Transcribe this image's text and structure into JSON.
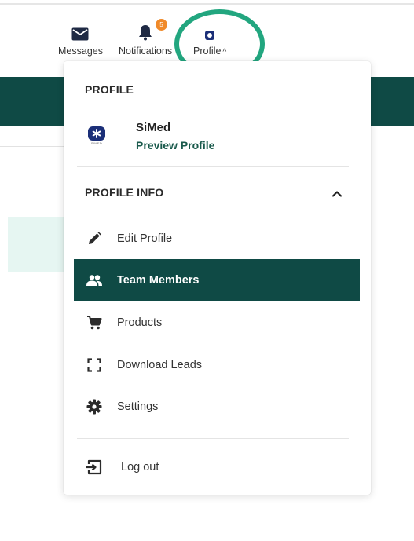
{
  "nav": {
    "messages_label": "Messages",
    "notifications_label": "Notifications",
    "notifications_badge": "5",
    "profile_label": "Profile",
    "profile_caret": "^"
  },
  "menu": {
    "profile_title": "PROFILE",
    "org_name": "SiMed",
    "org_logo_text": "SIMED",
    "preview_profile": "Preview Profile",
    "profile_info_title": "PROFILE INFO",
    "items": [
      {
        "label": "Edit Profile",
        "icon": "pencil-icon",
        "active": false
      },
      {
        "label": "Team Members",
        "icon": "group-icon",
        "active": true
      },
      {
        "label": "Products",
        "icon": "cart-icon",
        "active": false
      },
      {
        "label": "Download Leads",
        "icon": "frame-corners-icon",
        "active": false
      },
      {
        "label": "Settings",
        "icon": "gear-icon",
        "active": false
      }
    ],
    "logout_label": "Log out"
  },
  "colors": {
    "brand_dark": "#0f4a45",
    "link": "#1a5a4c",
    "highlight_ring": "#22a67f",
    "badge": "#f08a2a",
    "logo": "#1b2f78"
  }
}
